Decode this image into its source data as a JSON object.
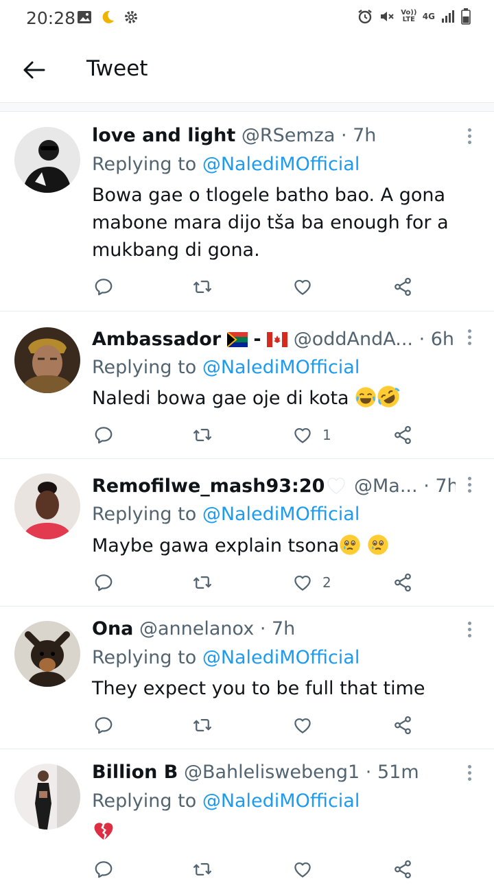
{
  "status_bar": {
    "time": "20:28",
    "net_line1": "Vo)) LTE",
    "net_line2": "4G"
  },
  "header": {
    "title": "Tweet"
  },
  "colors": {
    "mention": "#1d9bf0",
    "secondary_text": "#536471",
    "divider": "#e6ecf0"
  },
  "tweets": [
    {
      "name": "love and light",
      "handle": "@RSemza",
      "time": "· 7h",
      "reply_prefix": "Replying to",
      "reply_to": "@NalediMOfficial",
      "body": "Bowa gae o tlogele batho bao. A gona mabone mara dijo tša ba enough for a mukbang di gona.",
      "like_count": ""
    },
    {
      "name": "Ambassador",
      "name_suffix_icons": "south-africa-flag, canada-flag",
      "handle": "@oddAndA...",
      "time": "· 6h",
      "reply_prefix": "Replying to",
      "reply_to": "@NalediMOfficial",
      "body": "Naledi bowa gae oje di kota",
      "body_emojis": "crying-laughing, rolling-laughing",
      "like_count": "1"
    },
    {
      "name": "Remofilwe_mash93:20",
      "handle": "@Ma...",
      "time": "· 7h",
      "reply_prefix": "Replying to",
      "reply_to": "@NalediMOfficial",
      "body": "Maybe gawa explain tsona",
      "body_emojis": "holding-back-tears, holding-back-tears",
      "like_count": "2"
    },
    {
      "name": "Ona",
      "handle": "@annelanox",
      "time": "· 7h",
      "reply_prefix": "Replying to",
      "reply_to": "@NalediMOfficial",
      "body": "They expect you to be full that time",
      "like_count": ""
    },
    {
      "name": "Billion B",
      "handle": "@Bahleliswebeng1",
      "time": "· 51m",
      "reply_prefix": "Replying to",
      "reply_to": "@NalediMOfficial",
      "body": "",
      "body_emojis": "broken-heart",
      "like_count": ""
    }
  ]
}
